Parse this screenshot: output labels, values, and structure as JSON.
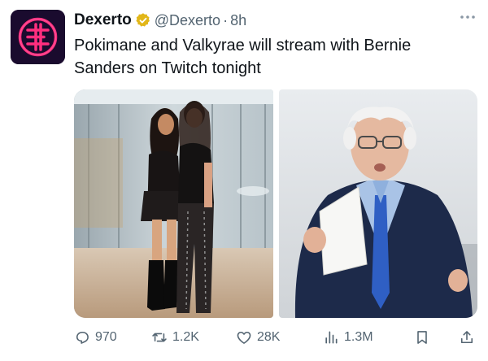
{
  "account": {
    "name": "Dexerto",
    "handle": "@Dexerto",
    "separator": "·",
    "time": "8h"
  },
  "avatar_icon": "dexerto-logo",
  "verified_icon": "verified-badge-icon",
  "more_icon": "more-dots-icon",
  "tweet": {
    "text": "Pokimane and Valkyrae will stream with Bernie Sanders on Twitch tonight"
  },
  "media": [
    {
      "kind": "photo",
      "subject": "two-women-photo"
    },
    {
      "kind": "photo",
      "subject": "man-holding-paper-photo"
    }
  ],
  "actions": {
    "reply_count": "970",
    "retweet_count": "1.2K",
    "like_count": "28K",
    "view_count": "1.3M"
  },
  "colors": {
    "text": "#0f1419",
    "muted": "#536471",
    "verified_gold": "#e2b719",
    "avatar_bg": "#1a0b2e",
    "avatar_accent": "#ff2e7e"
  }
}
